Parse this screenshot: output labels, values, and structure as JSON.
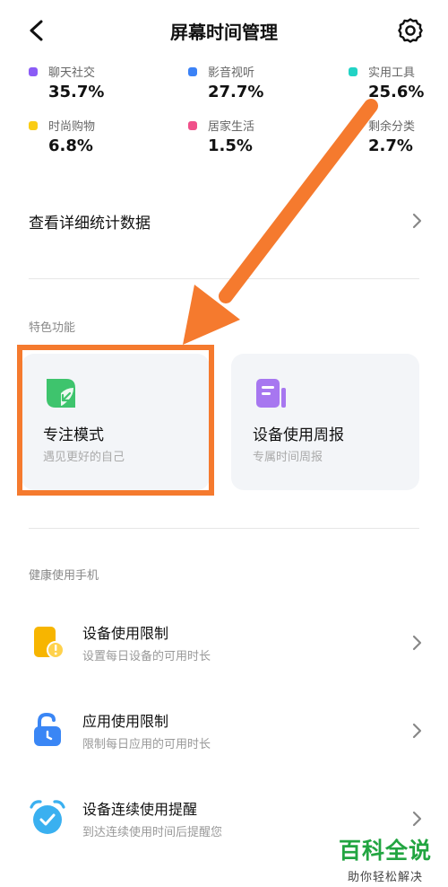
{
  "header": {
    "title": "屏幕时间管理",
    "back_icon": "back-arrow-icon",
    "settings_icon": "gear-icon"
  },
  "stats": [
    {
      "label": "聊天社交",
      "value": "35.7%",
      "color": "#8b5cf6"
    },
    {
      "label": "影音视听",
      "value": "27.7%",
      "color": "#3b82f6"
    },
    {
      "label": "实用工具",
      "value": "25.6%",
      "color": "#22d3c5"
    },
    {
      "label": "时尚购物",
      "value": "6.8%",
      "color": "#facc15"
    },
    {
      "label": "居家生活",
      "value": "1.5%",
      "color": "#f0508a"
    },
    {
      "label": "剩余分类",
      "value": "2.7%",
      "color": "#ffffff"
    }
  ],
  "detail": {
    "label": "查看详细统计数据"
  },
  "features": {
    "section_title": "特色功能",
    "cards": [
      {
        "title": "专注模式",
        "subtitle": "遇见更好的自己",
        "icon": "focus-leaf-icon",
        "color": "#3ec46d"
      },
      {
        "title": "设备使用周报",
        "subtitle": "专属时间周报",
        "icon": "report-book-icon",
        "color": "#a777f0"
      }
    ]
  },
  "health": {
    "section_title": "健康使用手机",
    "items": [
      {
        "title": "设备使用限制",
        "subtitle": "设置每日设备的可用时长",
        "icon": "device-limit-icon",
        "color": "#f7b500"
      },
      {
        "title": "应用使用限制",
        "subtitle": "限制每日应用的可用时长",
        "icon": "unlock-timer-icon",
        "color": "#3a86f5"
      },
      {
        "title": "设备连续使用提醒",
        "subtitle": "到达连续使用时间后提醒您",
        "icon": "alarm-clock-icon",
        "color": "#3ab0f0"
      }
    ]
  },
  "annotation": {
    "color": "#f57a2e"
  },
  "watermark": {
    "brand": "百科全说",
    "tagline": "助你轻松解决",
    "color": "#22a541"
  }
}
